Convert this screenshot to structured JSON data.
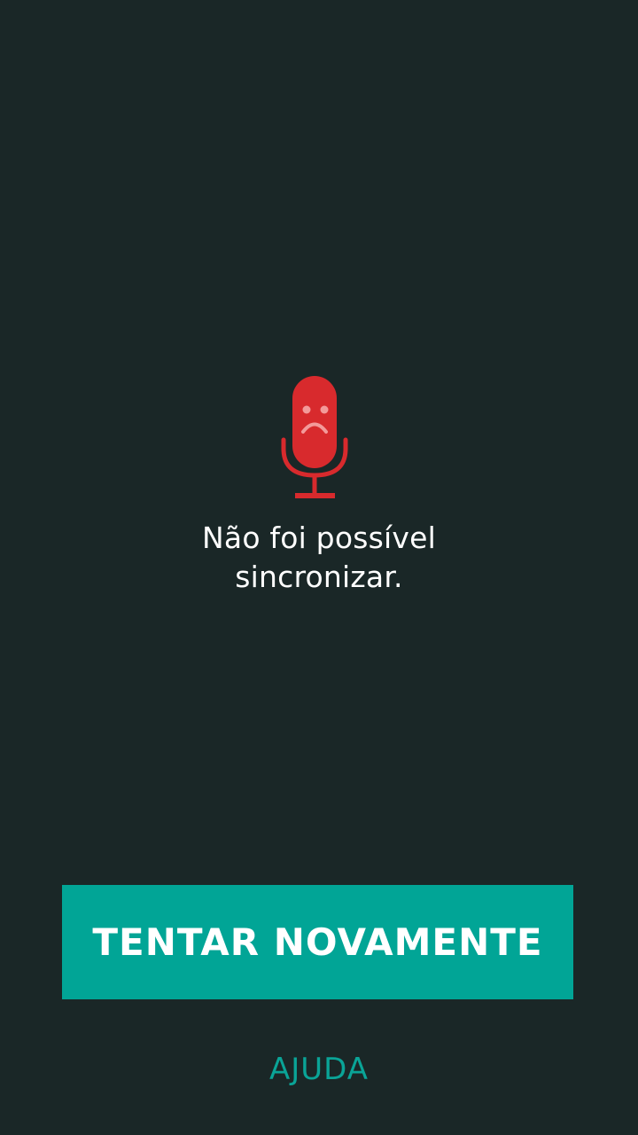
{
  "colors": {
    "background": "#1a2727",
    "accent": "#01a596",
    "error": "#d82a2d",
    "help_text": "#0aa497"
  },
  "error": {
    "icon": "sad-microphone-icon",
    "message_line1": "Não foi possível",
    "message_line2": "sincronizar."
  },
  "actions": {
    "retry_label": "TENTAR NOVAMENTE",
    "help_label": "AJUDA"
  }
}
